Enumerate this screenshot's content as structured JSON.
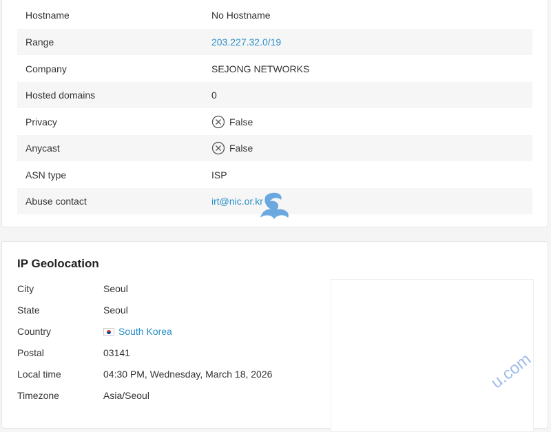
{
  "details": [
    {
      "label": "Hostname",
      "value": "No Hostname",
      "type": "text"
    },
    {
      "label": "Range",
      "value": "203.227.32.0/19",
      "type": "link"
    },
    {
      "label": "Company",
      "value": "SEJONG NETWORKS",
      "type": "text"
    },
    {
      "label": "Hosted domains",
      "value": "0",
      "type": "text"
    },
    {
      "label": "Privacy",
      "value": "False",
      "type": "bool",
      "icon": "x-circle-icon"
    },
    {
      "label": "Anycast",
      "value": "False",
      "type": "bool",
      "icon": "x-circle-icon"
    },
    {
      "label": "ASN type",
      "value": "ISP",
      "type": "text"
    },
    {
      "label": "Abuse contact",
      "value": "irt@nic.or.kr",
      "type": "link"
    }
  ],
  "geolocation": {
    "title": "IP Geolocation",
    "rows": [
      {
        "label": "City",
        "value": "Seoul"
      },
      {
        "label": "State",
        "value": "Seoul"
      },
      {
        "label": "Country",
        "value": "South Korea",
        "flag_icon": "south-korea-flag-icon"
      },
      {
        "label": "Postal",
        "value": "03141"
      },
      {
        "label": "Local time",
        "value": "04:30 PM, Wednesday, March 18, 2026"
      },
      {
        "label": "Timezone",
        "value": "Asia/Seoul"
      }
    ]
  },
  "watermark": {
    "text": "u.com"
  },
  "colors": {
    "link": "#2a8fc8",
    "row_shade": "#f6f6f6",
    "card_border": "#e6e6e6"
  }
}
